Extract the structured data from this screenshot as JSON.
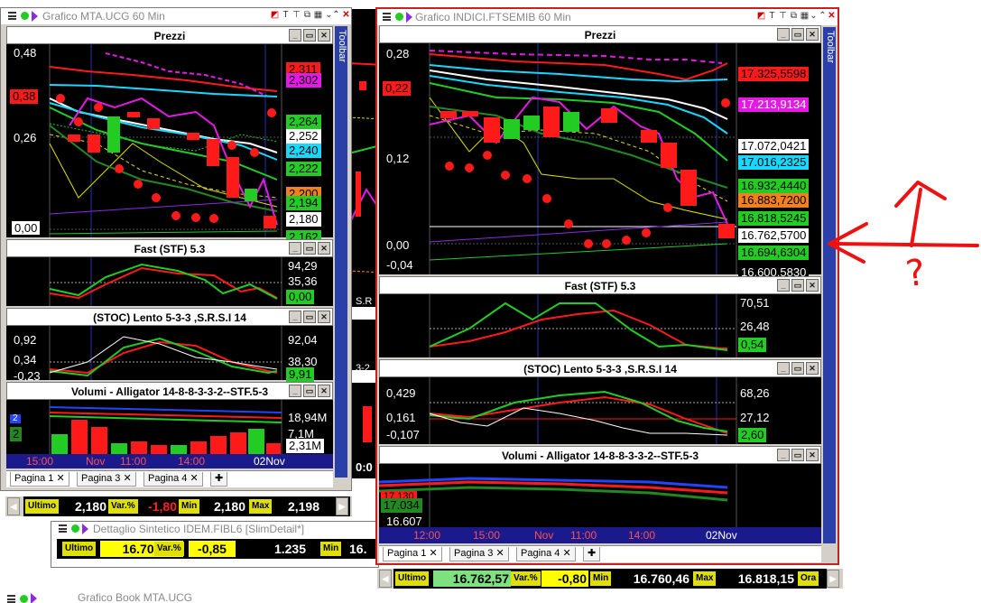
{
  "colors": {
    "up": "#22cc22",
    "down": "#ff1a1a",
    "magenta": "#e41ae4",
    "cyan": "#18d8ff",
    "bg": "#000000",
    "accent": "#8a2be2"
  },
  "left": {
    "title": "Grafico MTA.UCG 60 Min",
    "toolbar": "Toolbar",
    "prezzi": {
      "header": "Prezzi",
      "y_labels": [
        "0,48",
        "0,26",
        "0,00"
      ],
      "left_tag": "0,38",
      "tags": [
        {
          "text": "2,311",
          "bg": "#ff1a1a",
          "fg": "#000"
        },
        {
          "text": "2,302",
          "bg": "#e41ae4",
          "fg": "#000"
        },
        {
          "text": "2,264",
          "bg": "#22cc22",
          "fg": "#000"
        },
        {
          "text": "2,252",
          "bg": "#ffffff",
          "fg": "#000"
        },
        {
          "text": "2,240",
          "bg": "#18d8ff",
          "fg": "#000"
        },
        {
          "text": "2,222",
          "bg": "#22cc22",
          "fg": "#000"
        },
        {
          "text": "2,200",
          "bg": "#f08020",
          "fg": "#000"
        },
        {
          "text": "2,194",
          "bg": "#22cc22",
          "fg": "#000"
        },
        {
          "text": "2,180",
          "bg": "#ffffff",
          "fg": "#000"
        },
        {
          "text": "2,162",
          "bg": "#22cc22",
          "fg": "#000"
        }
      ]
    },
    "fast": {
      "header": "Fast  (STF)   5.3",
      "y_right": [
        "94,29",
        "35,36"
      ],
      "tag": "0,00"
    },
    "stoc": {
      "header": "(STOC) Lento   5-3-3 ,S.R.S.I 14",
      "y_left": [
        "0,92",
        "0,34",
        "-0,23"
      ],
      "y_right": [
        "92,04",
        "38,30"
      ],
      "tag": "9,91"
    },
    "vol": {
      "header": "Volumi - Alligator 14-8-8-3-3-2--STF.5-3",
      "y_right": [
        "18,94M",
        "7,1M"
      ],
      "tag": "2,31M",
      "left_tags": [
        "2",
        "2"
      ]
    },
    "xaxis": [
      "15:00",
      "Nov",
      "11:00",
      "14:00",
      "02Nov"
    ],
    "tabs": [
      "Pagina 1",
      "Pagina 3",
      "Pagina 4"
    ],
    "quote": {
      "ultimo_lbl": "Ultimo",
      "ultimo": "2,180",
      "var_lbl": "Var.%",
      "var": "-1,80",
      "min_lbl": "Min",
      "min": "2,180",
      "max_lbl": "Max",
      "max": "2,198"
    }
  },
  "middle": {
    "title": "Dettaglio Sintetico IDEM.FIBL6 [SlimDetail*]",
    "quote": {
      "ultimo_lbl": "Ultimo",
      "ultimo": "16.705",
      "var_lbl": "Var.%",
      "var": "-0,85",
      "qty": "1.235",
      "min_lbl": "Min",
      "min": "16."
    },
    "bottom_title": "Grafico Book MTA.UCG",
    "fragments": [
      "S.R",
      "3-2",
      "0:0"
    ]
  },
  "right": {
    "title": "Grafico INDICI.FTSEMIB 60 Min",
    "toolbar": "Toolbar",
    "prezzi": {
      "header": "Prezzi",
      "y_labels": [
        "0,28",
        "0,12",
        "0,00",
        "-0,04"
      ],
      "left_tag": "0,22",
      "tags": [
        {
          "text": "17.325,5598",
          "bg": "#ff1a1a",
          "fg": "#000"
        },
        {
          "text": "17.213,9134",
          "bg": "#e41ae4",
          "fg": "#fff"
        },
        {
          "text": "17.072,0421",
          "bg": "#ffffff",
          "fg": "#000"
        },
        {
          "text": "17.016,2325",
          "bg": "#18d8ff",
          "fg": "#000"
        },
        {
          "text": "16.932,4440",
          "bg": "#22cc22",
          "fg": "#000"
        },
        {
          "text": "16.883,7200",
          "bg": "#f08020",
          "fg": "#000"
        },
        {
          "text": "16.818,5245",
          "bg": "#22cc22",
          "fg": "#000"
        },
        {
          "text": "16.762,5700",
          "bg": "#ffffff",
          "fg": "#000"
        },
        {
          "text": "16.694,6304",
          "bg": "#22cc22",
          "fg": "#000"
        },
        {
          "text": "16.600,5830",
          "bg": "#000000",
          "fg": "#fff"
        }
      ]
    },
    "fast": {
      "header": "Fast  (STF)   5.3",
      "y_right": [
        "70,51",
        "26,48"
      ],
      "tag": "0,54"
    },
    "stoc": {
      "header": "(STOC) Lento   5-3-3 ,S.R.S.I 14",
      "y_left": [
        "0,429",
        "0,161",
        "-0,107"
      ],
      "y_right": [
        "68,26",
        "27,12"
      ],
      "tag": "2,60"
    },
    "vol": {
      "header": "Volumi - Alligator 14-8-8-3-3-2--STF.5-3",
      "y_left": [
        "17.034",
        "16.607"
      ],
      "left_tag": "17.130"
    },
    "xaxis": [
      "12:00",
      "15:00",
      "Nov",
      "11:00",
      "14:00",
      "02Nov"
    ],
    "tabs": [
      "Pagina 1",
      "Pagina 3",
      "Pagina 4"
    ],
    "quote": {
      "ultimo_lbl": "Ultimo",
      "ultimo": "16.762,57",
      "var_lbl": "Var.%",
      "var": "-0,80",
      "min_lbl": "Min",
      "min": "16.760,46",
      "max_lbl": "Max",
      "max": "16.818,15",
      "ora_lbl": "Ora"
    }
  },
  "annotation": {
    "question": "?"
  }
}
